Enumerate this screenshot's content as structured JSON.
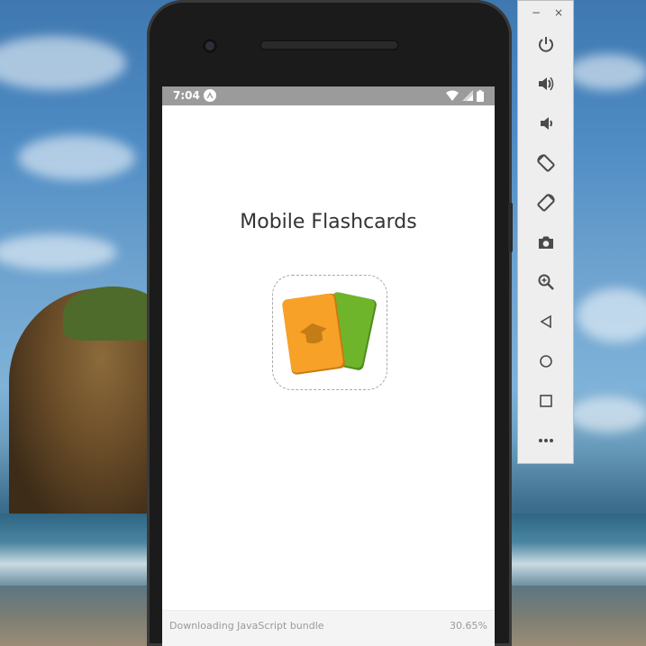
{
  "status_bar": {
    "time": "7:04",
    "icons": [
      "expo-icon",
      "wifi-icon",
      "signal-icon",
      "battery-icon"
    ]
  },
  "app": {
    "title": "Mobile Flashcards",
    "icon_name": "flashcards-graduation-cap-icon"
  },
  "loading": {
    "message": "Downloading JavaScript bundle",
    "percent": "30.65%"
  },
  "emulator_toolbar": {
    "window_controls": [
      "minimize-icon",
      "close-icon"
    ],
    "minimize_glyph": "−",
    "close_glyph": "×",
    "buttons": [
      "power-icon",
      "volume-up-icon",
      "volume-down-icon",
      "rotate-left-icon",
      "rotate-right-icon",
      "screenshot-camera-icon",
      "zoom-icon",
      "back-icon",
      "home-icon",
      "overview-icon",
      "more-icon"
    ]
  },
  "colors": {
    "status_bar": "#9b9b9b",
    "card_orange": "#f7a128",
    "card_green": "#6fb52c",
    "toolbar_icon": "#4a4a4a"
  }
}
